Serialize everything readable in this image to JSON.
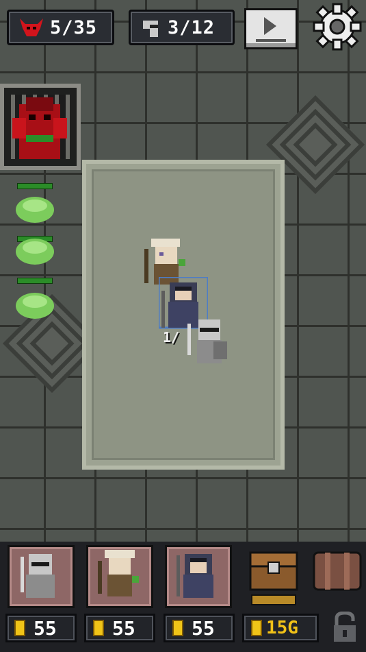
{
  "hud": {
    "wave": "5/35",
    "heroes": "3/12",
    "wave_icon": "demon-head-icon",
    "hero_icon": "helmet-icon",
    "play_icon": "play-icon",
    "settings_icon": "gear-icon"
  },
  "battle": {
    "party_label": "1/"
  },
  "shop": {
    "cards": [
      {
        "name": "knight",
        "price": "55"
      },
      {
        "name": "elf-archer",
        "price": "55"
      },
      {
        "name": "mage",
        "price": "55"
      }
    ],
    "gold": "15G",
    "chest_icon": "treasure-chest-icon",
    "backpack_icon": "backpack-icon",
    "lock_icon": "unlock-icon"
  },
  "colors": {
    "gold": "#f2c218",
    "hp_green": "#2b8c28",
    "demon_red": "#c9141c"
  }
}
